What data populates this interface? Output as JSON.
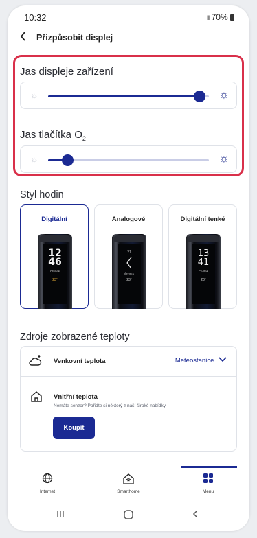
{
  "status_bar": {
    "time": "10:32",
    "signal": "Ill",
    "battery": "70%"
  },
  "header": {
    "back_icon": "chevron-left-icon",
    "title": "Přizpůsobit displej"
  },
  "brightness": {
    "display_title": "Jas displeje zařízení",
    "display_level": 0.94,
    "button_title_prefix": "Jas tlačítka O",
    "button_title_sub": "2",
    "button_level": 0.12
  },
  "clock_style": {
    "title": "Styl hodin",
    "options": [
      {
        "label": "Digitální",
        "selected": true,
        "time_top": "12",
        "time_bottom": "46",
        "date": "Čtvrtek",
        "temp": "23°"
      },
      {
        "label": "Analogové",
        "selected": false,
        "top_num": "21",
        "date": "Čtvrtek",
        "temp": "23°"
      },
      {
        "label": "Digitální tenké",
        "selected": false,
        "time_top": "13",
        "time_bottom": "41",
        "date": "Čtvrtek",
        "temp": "28°"
      }
    ]
  },
  "temperature_sources": {
    "title": "Zdroje zobrazené teploty",
    "outdoor_label": "Venkovní teplota",
    "outdoor_source": "Meteostanice",
    "indoor_label": "Vnitřní teplota",
    "indoor_note": "Nemáte senzor? Pořiďte si některý z naší široké nabídky.",
    "buy_label": "Koupit"
  },
  "nav": {
    "items": [
      {
        "label": "Internet",
        "icon": "globe-icon"
      },
      {
        "label": "Smarthome",
        "icon": "home-wifi-icon"
      },
      {
        "label": "Menu",
        "icon": "grid-icon",
        "active": true
      }
    ]
  },
  "colors": {
    "accent": "#1b2a93",
    "highlight": "#d9304a",
    "temp_accent": "#f5b93a"
  }
}
